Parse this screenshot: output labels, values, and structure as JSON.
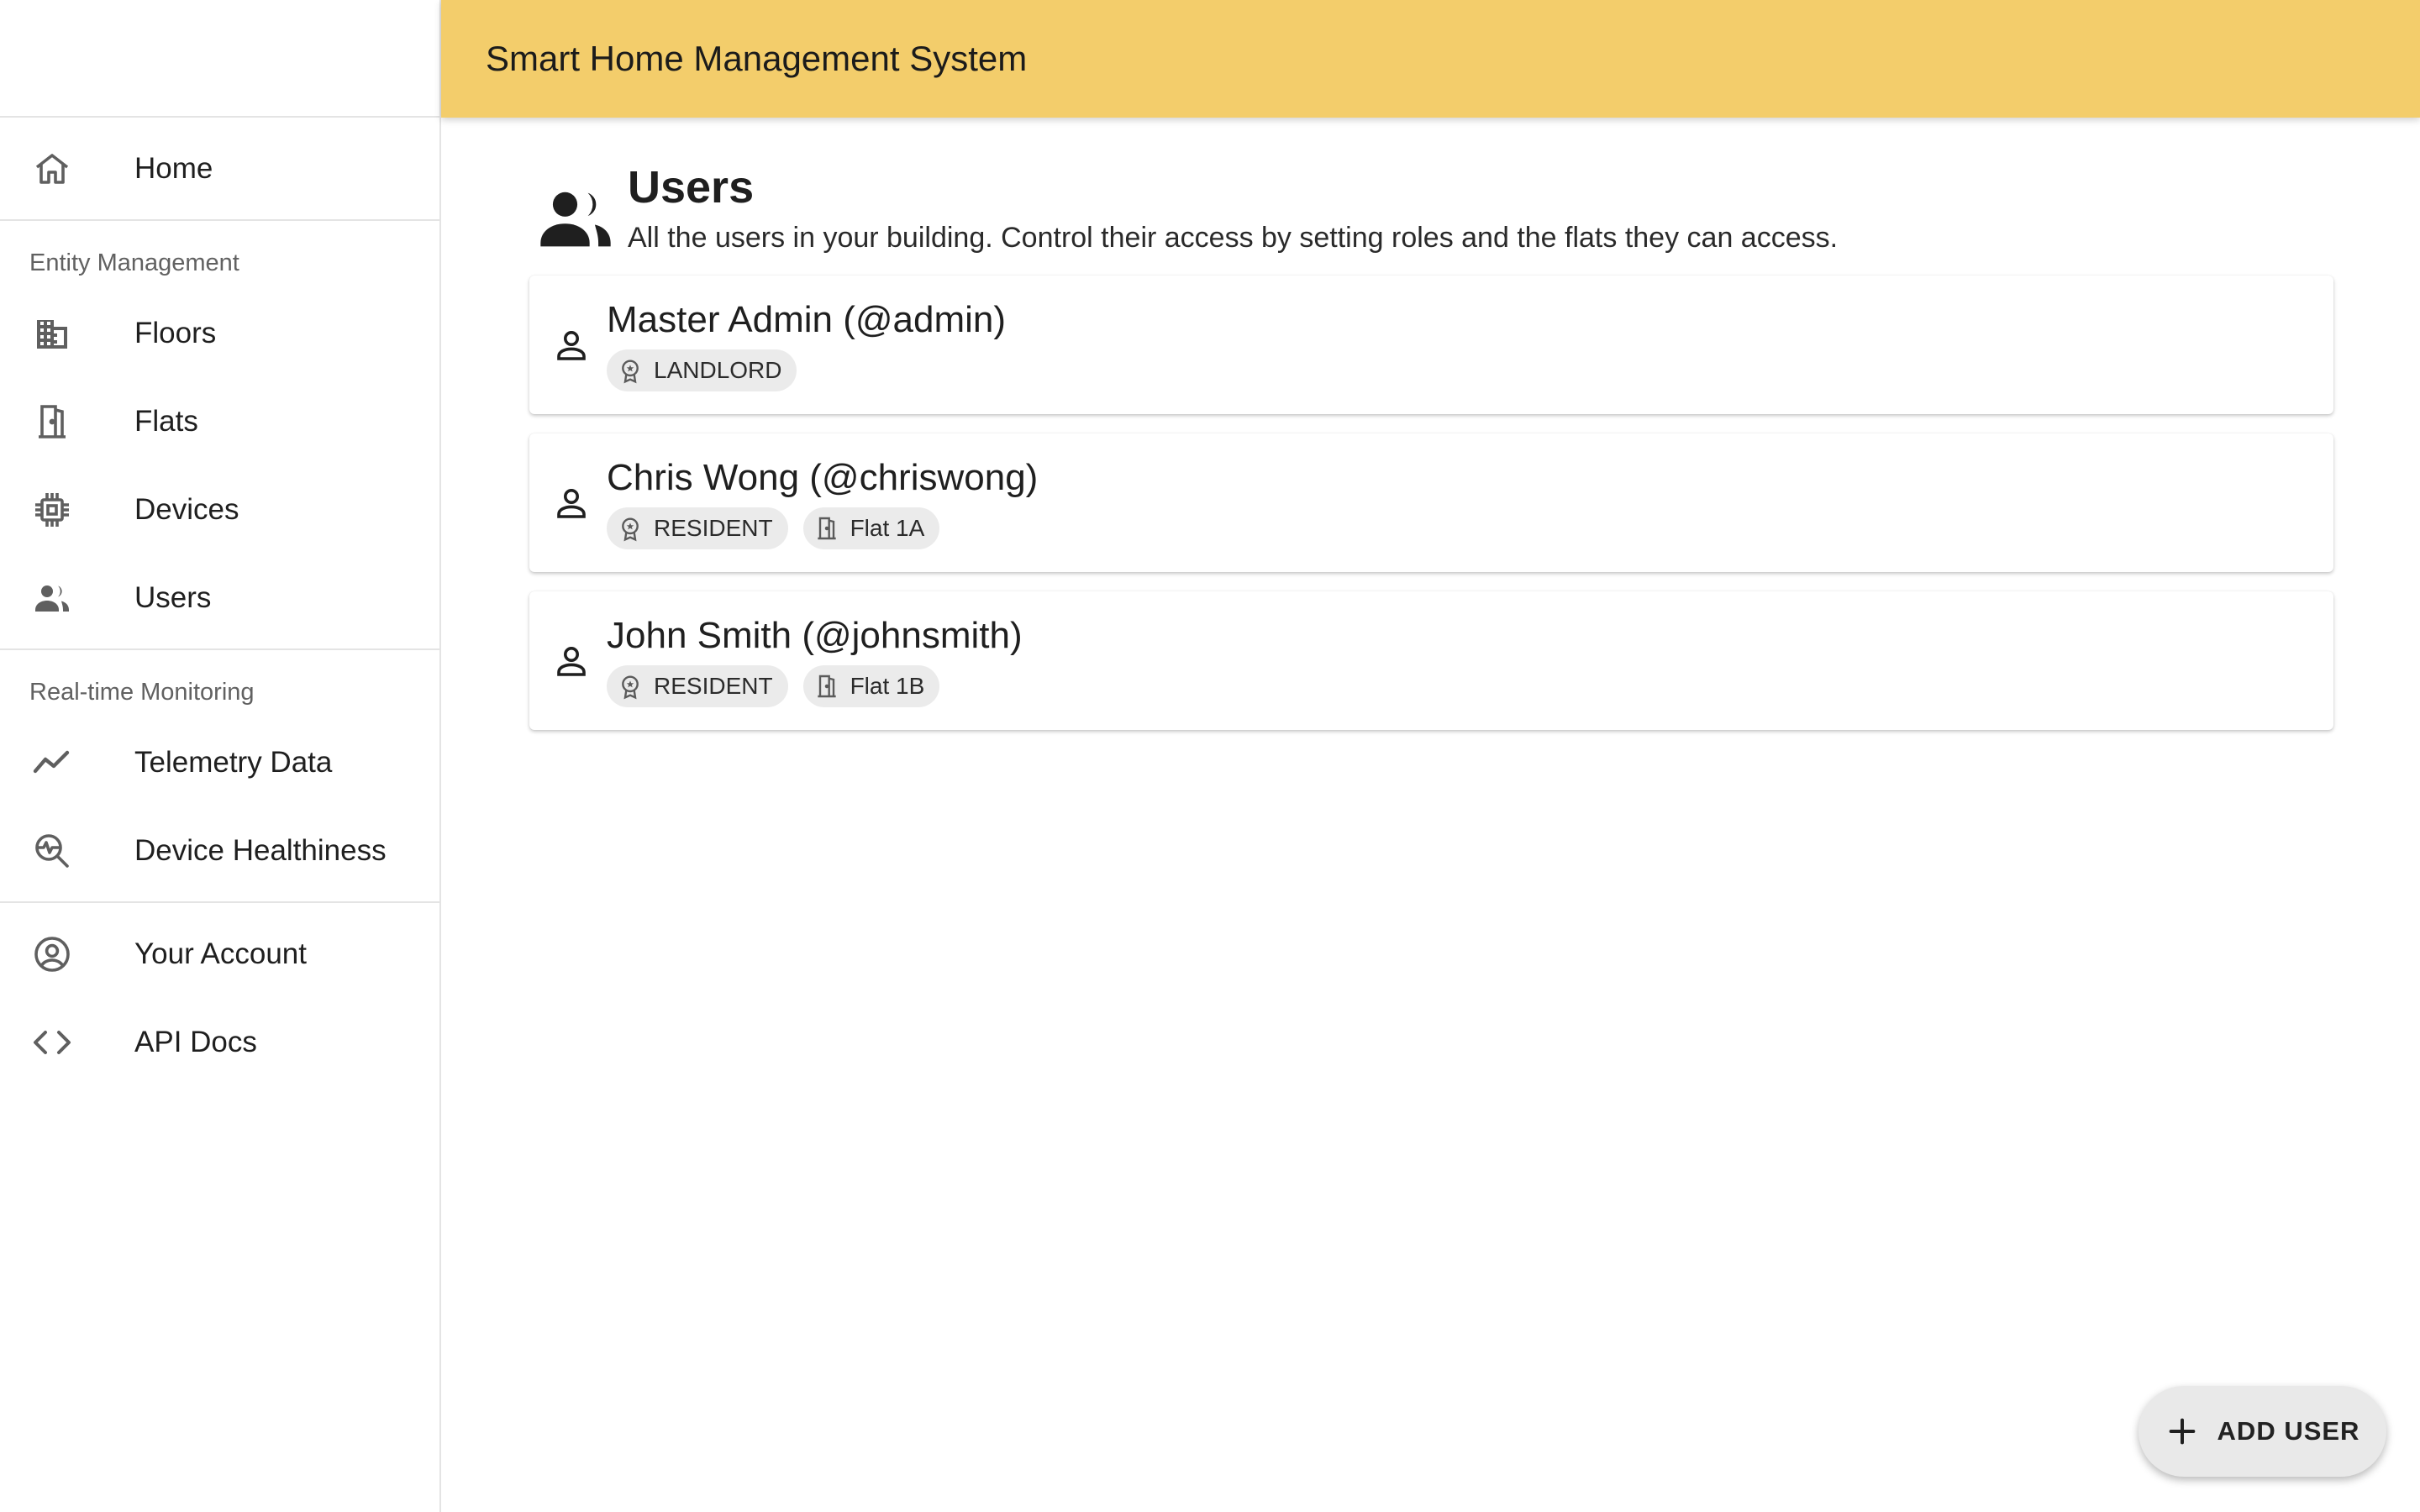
{
  "header": {
    "title": "Smart Home Management System"
  },
  "sidebar": {
    "home": {
      "label": "Home",
      "icon": "home-icon"
    },
    "entity_section": {
      "title": "Entity Management",
      "items": [
        {
          "label": "Floors",
          "icon": "building-icon"
        },
        {
          "label": "Flats",
          "icon": "door-icon"
        },
        {
          "label": "Devices",
          "icon": "chip-icon"
        },
        {
          "label": "Users",
          "icon": "people-icon"
        }
      ]
    },
    "monitoring_section": {
      "title": "Real-time Monitoring",
      "items": [
        {
          "label": "Telemetry Data",
          "icon": "trend-icon"
        },
        {
          "label": "Device Healthiness",
          "icon": "health-search-icon"
        }
      ]
    },
    "account_items": [
      {
        "label": "Your Account",
        "icon": "account-circle-icon"
      },
      {
        "label": "API Docs",
        "icon": "code-icon"
      }
    ]
  },
  "page": {
    "title": "Users",
    "description": "All the users in your building. Control their access by setting roles and the flats they can access."
  },
  "users": [
    {
      "name": "Master Admin (@admin)",
      "role": "LANDLORD",
      "flat": ""
    },
    {
      "name": "Chris Wong (@chriswong)",
      "role": "RESIDENT",
      "flat": "Flat 1A"
    },
    {
      "name": "John Smith (@johnsmith)",
      "role": "RESIDENT",
      "flat": "Flat 1B"
    }
  ],
  "fab": {
    "label": "ADD USER",
    "icon": "plus-icon"
  },
  "colors": {
    "header_bg": "#f3cd6b",
    "chip_bg": "#ebebeb",
    "fab_bg": "#e9e9e9"
  }
}
